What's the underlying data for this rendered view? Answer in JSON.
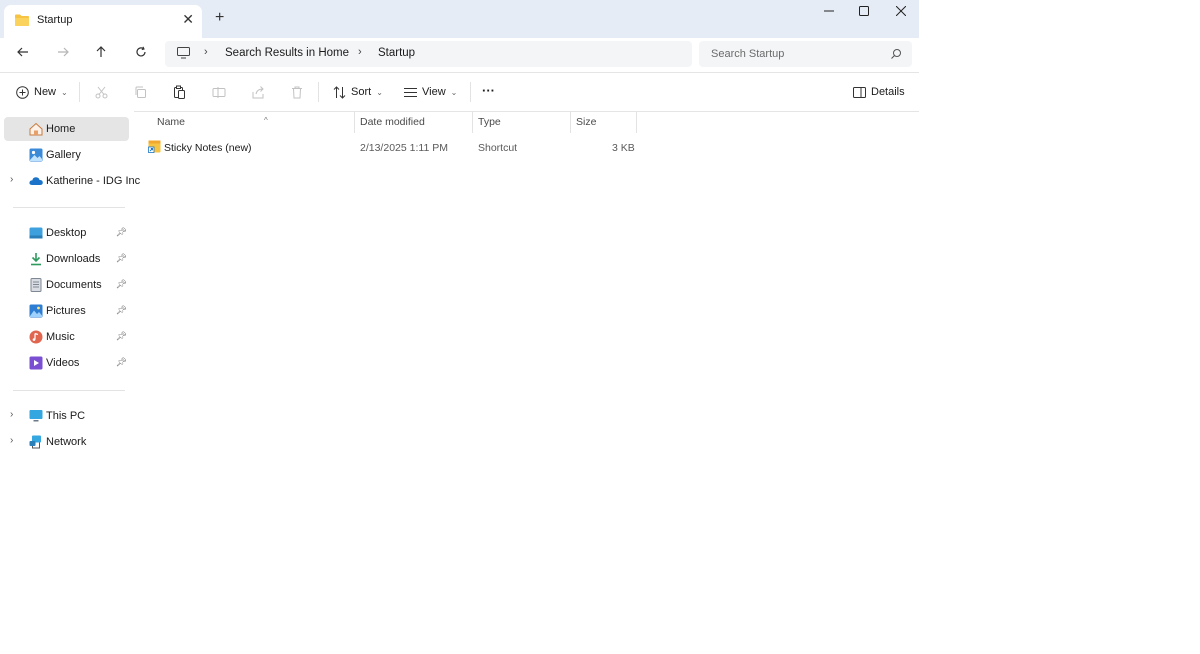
{
  "window": {
    "tab_title": "Startup",
    "new_tab_symbol": "+",
    "tab_close_symbol": "✕"
  },
  "address_bar": {
    "crumbs": [
      "Search Results in Home",
      "Startup"
    ],
    "search_placeholder": "Search Startup"
  },
  "command_bar": {
    "new_label": "New",
    "sort_label": "Sort",
    "view_label": "View",
    "more_label": "···",
    "details_label": "Details"
  },
  "nav_pane": {
    "top_items": [
      {
        "label": "Home",
        "icon": "home-icon",
        "selected": true
      },
      {
        "label": "Gallery",
        "icon": "gallery-icon"
      },
      {
        "label": "Katherine - IDG Inc",
        "icon": "onedrive-icon",
        "expandable": true
      }
    ],
    "pinned_items": [
      {
        "label": "Desktop",
        "icon": "desktop-icon"
      },
      {
        "label": "Downloads",
        "icon": "downloads-icon"
      },
      {
        "label": "Documents",
        "icon": "documents-icon"
      },
      {
        "label": "Pictures",
        "icon": "pictures-icon"
      },
      {
        "label": "Music",
        "icon": "music-icon"
      },
      {
        "label": "Videos",
        "icon": "videos-icon"
      }
    ],
    "bottom_items": [
      {
        "label": "This PC",
        "icon": "this-pc-icon",
        "expandable": true
      },
      {
        "label": "Network",
        "icon": "network-icon",
        "expandable": true
      }
    ]
  },
  "file_list": {
    "columns": [
      "Name",
      "Date modified",
      "Type",
      "Size"
    ],
    "rows": [
      {
        "name": "Sticky Notes (new)",
        "date_modified": "2/13/2025 1:11 PM",
        "type": "Shortcut",
        "size": "3 KB"
      }
    ]
  },
  "colors": {
    "titlebar_bg": "#e6ecf5",
    "selected_nav_bg": "#e5e5e5",
    "folder_yellow": "#f6c343",
    "accent_blue": "#1a73c8"
  }
}
